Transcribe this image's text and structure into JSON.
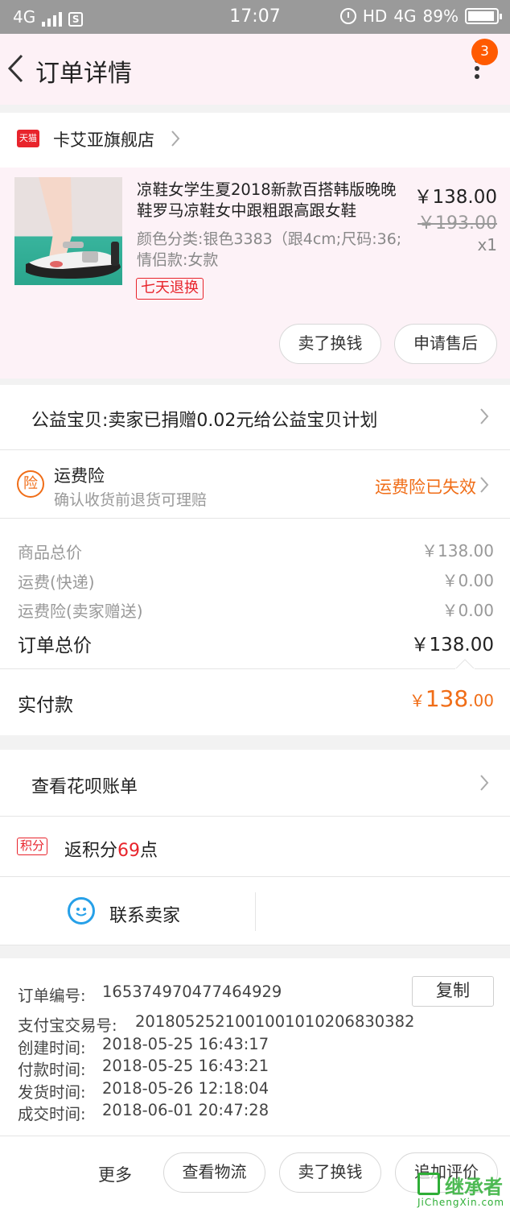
{
  "status_bar": {
    "network_left": "4G",
    "time": "17:07",
    "hd": "HD",
    "network_right": "4G",
    "battery": "89%"
  },
  "header": {
    "title": "订单详情",
    "badge": "3"
  },
  "store": {
    "tmall_label": "天猫",
    "name": "卡艾亚旗舰店"
  },
  "product": {
    "title": "凉鞋女学生夏2018新款百搭韩版晚晚鞋罗马凉鞋女中跟粗跟高跟女鞋",
    "spec": "颜色分类:银色3383（跟4cm;尺码:36;情侣款:女款",
    "refund_tag": "七天退换",
    "price": "￥138.00",
    "original_price": "￥193.00",
    "quantity": "x1",
    "buttons": [
      "卖了换钱",
      "申请售后"
    ]
  },
  "charity": {
    "text": "公益宝贝:卖家已捐赠0.02元给公益宝贝计划"
  },
  "insurance": {
    "icon_label": "险",
    "title": "运费险",
    "subtitle": "确认收货前退货可理赔",
    "status": "运费险已失效"
  },
  "costs": {
    "rows": [
      {
        "label": "商品总价",
        "value": "￥138.00"
      },
      {
        "label": "运费(快递)",
        "value": "￥0.00"
      },
      {
        "label": "运费险(卖家赠送)",
        "value": "￥0.00"
      }
    ],
    "total_label": "订单总价",
    "total_value": "￥138.00",
    "paid_label": "实付款",
    "paid_symbol": "￥",
    "paid_int": "138",
    "paid_dec": ".00"
  },
  "huabei": {
    "text": "查看花呗账单"
  },
  "points": {
    "tag": "积分",
    "prefix": "返积分",
    "value": "69",
    "suffix": "点"
  },
  "contact": {
    "label": "联系卖家"
  },
  "order_info": {
    "copy_label": "复制",
    "rows": [
      {
        "label": "订单编号:",
        "value": "165374970477464929"
      },
      {
        "label": "支付宝交易号:",
        "value": "2018052521001001010206830382"
      },
      {
        "label": "创建时间:",
        "value": "2018-05-25 16:43:17"
      },
      {
        "label": "付款时间:",
        "value": "2018-05-25 16:43:21"
      },
      {
        "label": "发货时间:",
        "value": "2018-05-26 12:18:04"
      },
      {
        "label": "成交时间:",
        "value": "2018-06-01 20:47:28"
      }
    ]
  },
  "bottom_bar": {
    "more": "更多",
    "buttons": [
      "查看物流",
      "卖了换钱",
      "追加评价"
    ]
  },
  "watermark": {
    "text": "JiChengXin.com",
    "logo_text": "继承者"
  },
  "colors": {
    "accent_orange": "#f06d17",
    "tmall_red": "#e8242c",
    "header_bg": "#fdf1f6",
    "contact_blue": "#26a0e8"
  }
}
